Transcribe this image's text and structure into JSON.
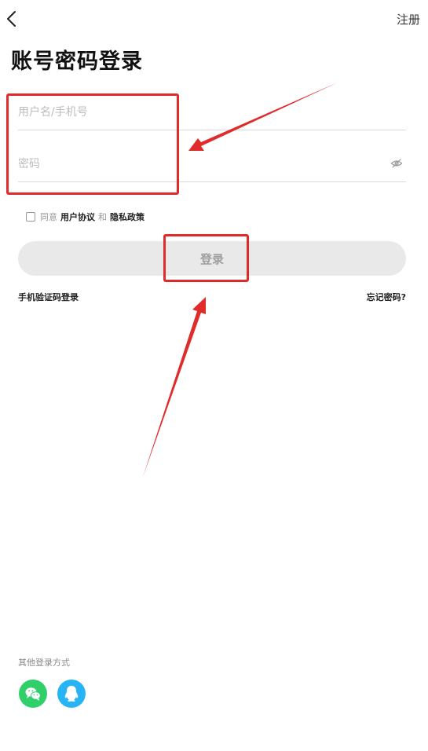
{
  "header": {
    "register_label": "注册"
  },
  "page": {
    "title": "账号密码登录"
  },
  "form": {
    "username_placeholder": "用户名/手机号",
    "password_placeholder": "密码"
  },
  "agreement": {
    "prefix": "同意",
    "user_agreement": "用户协议",
    "and": "和",
    "privacy_policy": "隐私政策"
  },
  "actions": {
    "login_label": "登录",
    "sms_login": "手机验证码登录",
    "forgot_password": "忘记密码?"
  },
  "other_login": {
    "label": "其他登录方式"
  },
  "icons": {
    "back": "chevron-left-icon",
    "eye": "eye-off-icon",
    "wechat": "wechat-icon",
    "qq": "qq-icon"
  },
  "colors": {
    "highlight": "#e02b2b",
    "arrow": "#e02b2b",
    "wechat": "#2fcf6a",
    "qq": "#27b4f5",
    "login_button_bg": "#e9e9e9",
    "login_button_text": "#9e9e9e"
  }
}
